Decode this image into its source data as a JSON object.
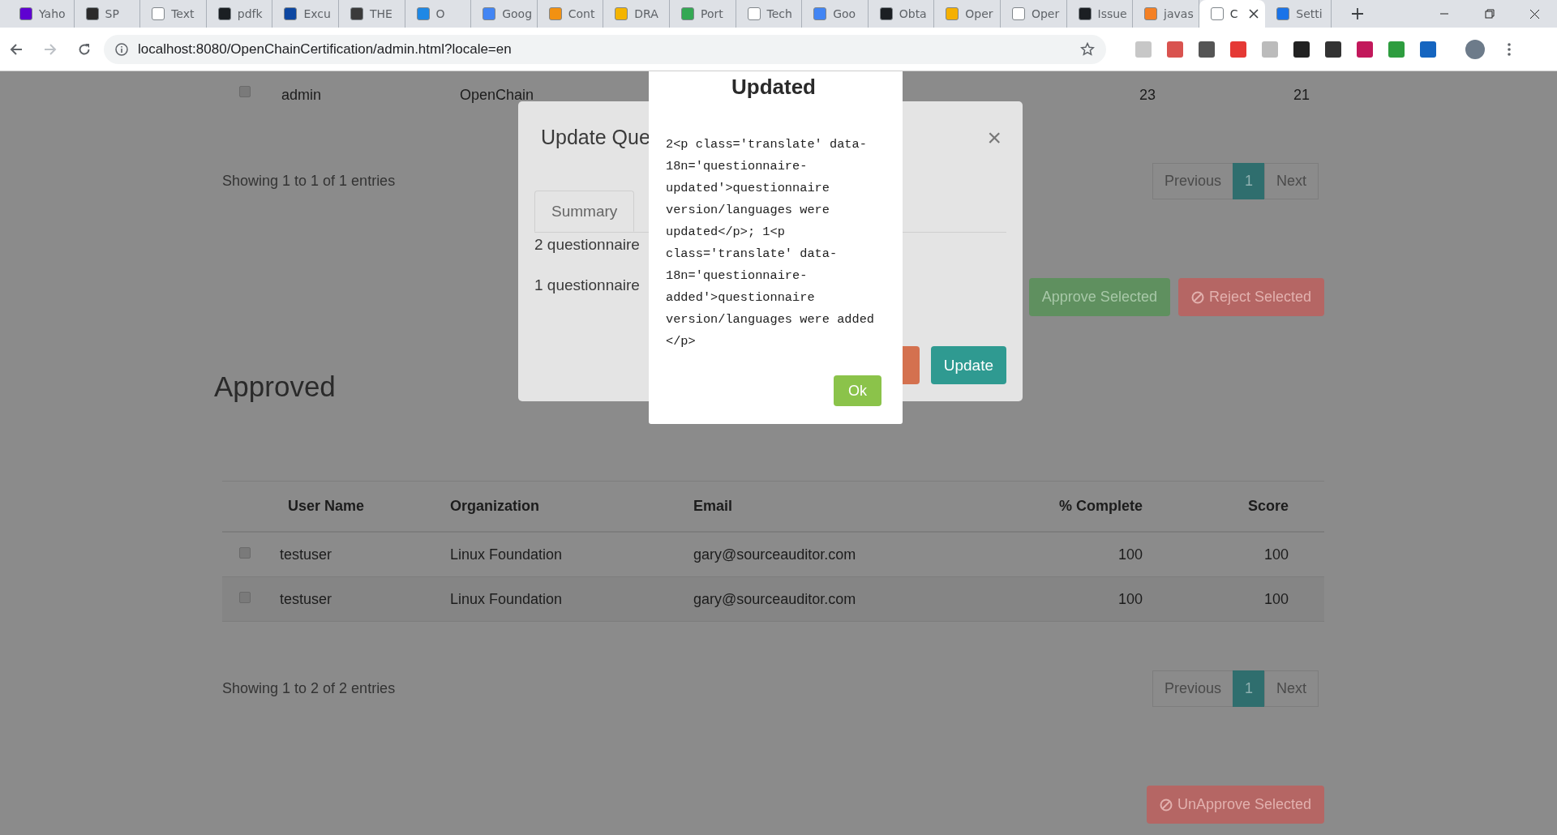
{
  "browser": {
    "tabs": [
      {
        "title": "Yaho",
        "color": "#5f01d1",
        "selected": false
      },
      {
        "title": "SP",
        "color": "#2b2b2b",
        "selected": false
      },
      {
        "title": "Text",
        "color": "#ffffff",
        "selected": false
      },
      {
        "title": "pdfk",
        "color": "#1b1f23",
        "selected": false
      },
      {
        "title": "Excu",
        "color": "#0d47a1",
        "selected": false
      },
      {
        "title": "THE",
        "color": "#3a3a3a",
        "selected": false
      },
      {
        "title": "O",
        "color": "#1e88e5",
        "selected": false
      },
      {
        "title": "Goog",
        "color": "#4285f4",
        "selected": false
      },
      {
        "title": "Cont",
        "color": "#f29111",
        "selected": false
      },
      {
        "title": "DRA",
        "color": "#f4b400",
        "selected": false
      },
      {
        "title": "Port",
        "color": "#34a853",
        "selected": false
      },
      {
        "title": "Tech",
        "color": "#ffffff",
        "selected": false
      },
      {
        "title": "Goo",
        "color": "#4285f4",
        "selected": false
      },
      {
        "title": "Obta",
        "color": "#1b1f23",
        "selected": false
      },
      {
        "title": "Oper",
        "color": "#f5b000",
        "selected": false
      },
      {
        "title": "Oper",
        "color": "#ffffff",
        "selected": false
      },
      {
        "title": "Issue",
        "color": "#1b1f23",
        "selected": false
      },
      {
        "title": "javas",
        "color": "#f48024",
        "selected": false
      },
      {
        "title": "C",
        "color": "#ffffff",
        "selected": true
      },
      {
        "title": "Setti",
        "color": "#1a73e8",
        "selected": false
      }
    ],
    "url": "localhost:8080/OpenChainCertification/admin.html?locale=en"
  },
  "pending": {
    "row": {
      "checked": false,
      "cells": [
        "admin",
        "OpenChain",
        "23",
        "21"
      ]
    },
    "info": "Showing 1 to 1 of 1 entries",
    "pagination": {
      "previous": "Previous",
      "pages": [
        {
          "label": "1",
          "selected": true
        }
      ],
      "next": "Next"
    },
    "actions": [
      {
        "label": "Approve Selected",
        "kind": "approve"
      },
      {
        "label": "Reject Selected",
        "kind": "reject"
      }
    ]
  },
  "approved": {
    "heading": "Approved",
    "columns": [
      "User Name",
      "Organization",
      "Email",
      "% Complete",
      "Score"
    ],
    "rows": [
      {
        "checked": false,
        "cells": [
          "testuser",
          "Linux Foundation",
          "gary@sourceauditor.com",
          "100",
          "100"
        ]
      },
      {
        "checked": false,
        "cells": [
          "testuser",
          "Linux Foundation",
          "gary@sourceauditor.com",
          "100",
          "100"
        ]
      }
    ],
    "info": "Showing 1 to 2 of 2 entries",
    "pagination": {
      "previous": "Previous",
      "pages": [
        {
          "label": "1",
          "selected": true
        }
      ],
      "next": "Next"
    },
    "actions": [
      {
        "label": "UnApprove Selected",
        "kind": "reject"
      }
    ]
  },
  "update_dialog": {
    "title": "Update Que",
    "tabs": [
      {
        "label": "Summary",
        "selected": true
      }
    ],
    "lines": [
      "2 questionnaire",
      "1 questionnaire"
    ],
    "close": "×",
    "update_button": "Update"
  },
  "alert": {
    "title": "Updated",
    "message": "2<p class='translate' data-18n='questionnaire-updated'>questionnaire version/languages were updated</p>; 1<p class='translate' data-18n='questionnaire-added'>questionnaire version/languages were added </p>",
    "ok": "Ok"
  }
}
